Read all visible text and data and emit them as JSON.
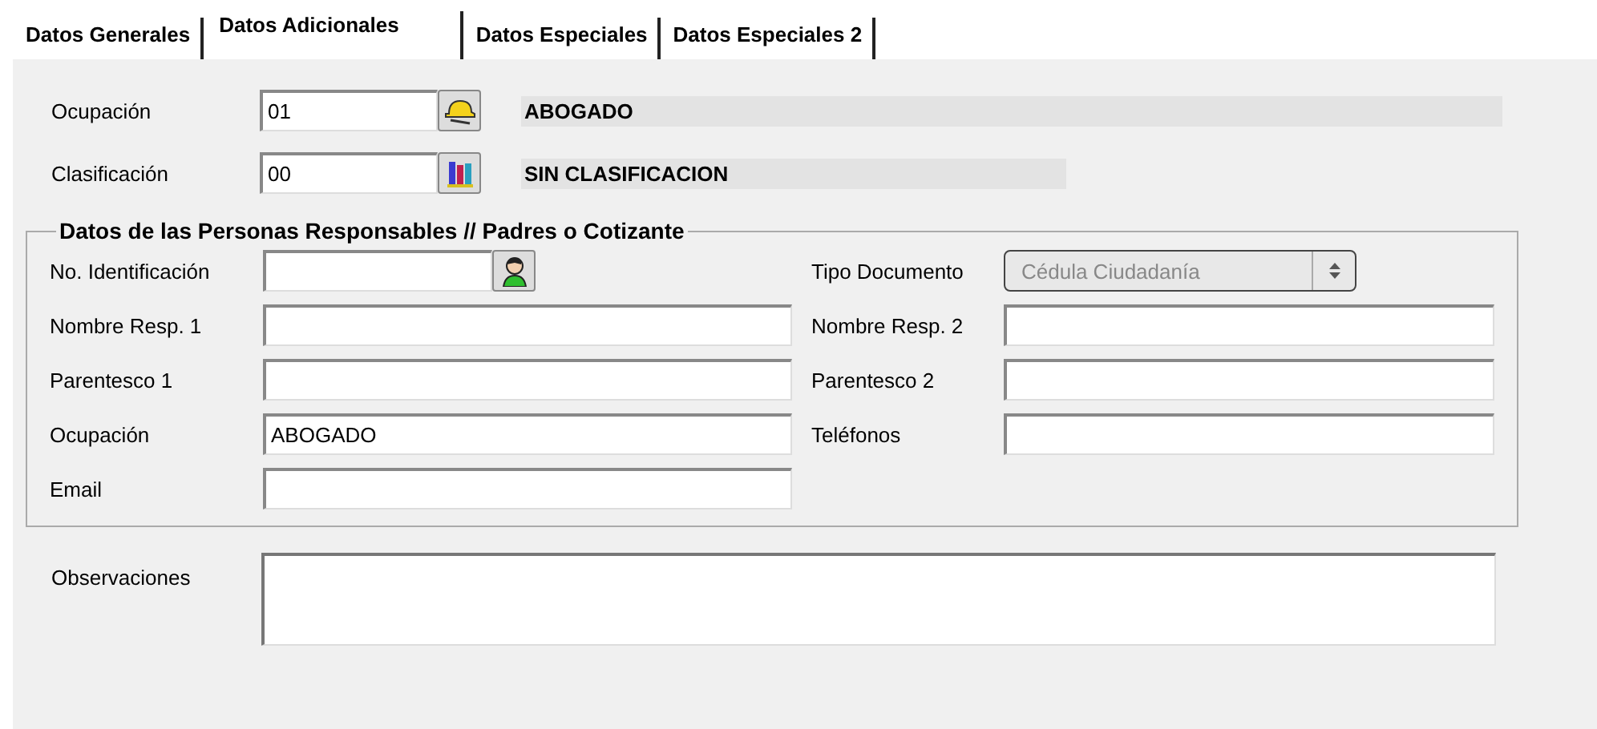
{
  "tabs": [
    {
      "label": "Datos Generales",
      "selected": false
    },
    {
      "label": "Datos Adicionales",
      "selected": true
    },
    {
      "label": "Datos Especiales",
      "selected": false
    },
    {
      "label": "Datos Especiales 2",
      "selected": false
    }
  ],
  "lookups": [
    {
      "label": "Ocupación",
      "value": "01",
      "description": "ABOGADO"
    },
    {
      "label": "Clasificación",
      "value": "00",
      "description": "SIN CLASIFICACION"
    }
  ],
  "responsables": {
    "title": "Datos de las Personas Responsables // Padres o Cotizante",
    "left": [
      {
        "kind": "lookup",
        "label": "No. Identificación"
      },
      {
        "kind": "text",
        "label": "Nombre Resp. 1"
      },
      {
        "kind": "text",
        "label": "Parentesco 1"
      },
      {
        "kind": "text",
        "label": "Ocupación",
        "value": "ABOGADO"
      },
      {
        "kind": "text",
        "label": "Email"
      }
    ],
    "right": [
      {
        "kind": "select",
        "label": "Tipo Documento",
        "value": "Cédula Ciudadanía",
        "disabled": true
      },
      {
        "kind": "text",
        "label": "Nombre Resp. 2"
      },
      {
        "kind": "text",
        "label": "Parentesco 2"
      },
      {
        "kind": "text",
        "label": "Teléfonos"
      }
    ]
  },
  "observaciones": {
    "label": "Observaciones"
  }
}
